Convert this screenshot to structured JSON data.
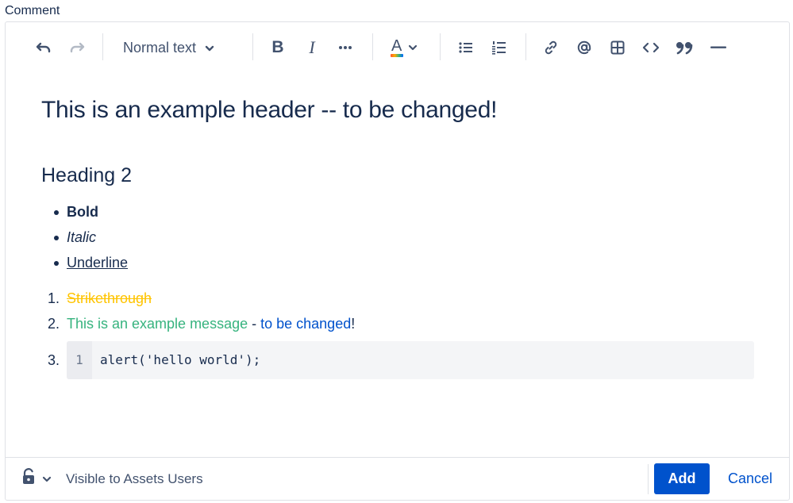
{
  "field_label": "Comment",
  "toolbar": {
    "undo_icon": "undo-icon",
    "redo_icon": "redo-icon",
    "text_style": "Normal text",
    "buttons": [
      "bold-icon",
      "italic-icon",
      "more-formatting-icon",
      "text-color-icon",
      "bullet-list-icon",
      "numbered-list-icon",
      "link-icon",
      "mention-icon",
      "table-icon",
      "code-icon",
      "quote-icon",
      "divider-icon"
    ],
    "bold_glyph": "B",
    "italic_glyph": "I",
    "color_glyph": "A"
  },
  "document": {
    "heading1": "This is an example header -- to be changed!",
    "heading2": "Heading 2",
    "bullets": [
      "Bold",
      "Italic",
      "Underline"
    ],
    "numbered": {
      "item1_num": "1.",
      "item1": "Strikethrough",
      "item2_num": "2.",
      "item2_green": "This is an example message",
      "item2_sep": " - ",
      "item2_blue": "to be changed",
      "item2_end": "!",
      "item3_num": "3."
    },
    "code": {
      "line_number": "1",
      "text": "alert('hello world');"
    }
  },
  "colors": {
    "text": "#172B4D",
    "strike": "#FFC400",
    "green": "#36B37E",
    "blue": "#0052CC",
    "primary_button": "#0052CC"
  },
  "footer": {
    "visibility_icon": "unlock-icon",
    "visibility_text": "Visible to Assets Users",
    "add_label": "Add",
    "cancel_label": "Cancel"
  }
}
